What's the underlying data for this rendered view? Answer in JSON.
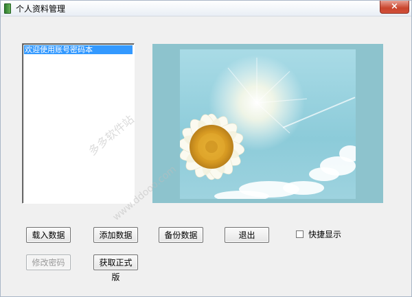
{
  "window": {
    "title": "个人资料管理",
    "close_glyph": "×"
  },
  "listbox": {
    "items": [
      "欢迎使用账号密码本"
    ]
  },
  "buttons": {
    "load": "载入数据",
    "add": "添加数据",
    "backup": "备份数据",
    "exit": "退出",
    "change_password": "修改密码",
    "get_full_version": "获取正式版"
  },
  "quick_show": {
    "label": "快捷显示",
    "checked": false
  },
  "watermark": {
    "text1": "多多软件站",
    "text2": "www.ddooo.com"
  },
  "colors": {
    "selection": "#3399ff",
    "close_button": "#c9452d",
    "picture_bg": "#8fc5cf"
  },
  "picture": {
    "subject": "daisy-against-blue-sky"
  }
}
